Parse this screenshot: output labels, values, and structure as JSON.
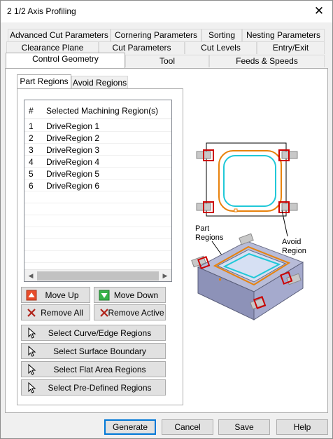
{
  "window": {
    "title": "2 1/2 Axis Profiling"
  },
  "tabs_row1": [
    {
      "label": "Advanced Cut Parameters"
    },
    {
      "label": "Cornering Parameters"
    },
    {
      "label": "Sorting"
    },
    {
      "label": "Nesting Parameters"
    }
  ],
  "tabs_row2": [
    {
      "label": "Clearance Plane"
    },
    {
      "label": "Cut Parameters"
    },
    {
      "label": "Cut Levels"
    },
    {
      "label": "Entry/Exit"
    }
  ],
  "tabs_row3": [
    {
      "label": "Control Geometry"
    },
    {
      "label": "Tool"
    },
    {
      "label": "Feeds & Speeds"
    }
  ],
  "subtabs": [
    {
      "label": "Part Regions"
    },
    {
      "label": "Avoid Regions"
    }
  ],
  "list": {
    "header_num": "#",
    "header_name": "Selected Machining Region(s)",
    "rows": [
      {
        "num": "1",
        "name": "DriveRegion 1"
      },
      {
        "num": "2",
        "name": "DriveRegion 2"
      },
      {
        "num": "3",
        "name": "DriveRegion 3"
      },
      {
        "num": "4",
        "name": "DriveRegion 4"
      },
      {
        "num": "5",
        "name": "DriveRegion 5"
      },
      {
        "num": "6",
        "name": "DriveRegion 6"
      }
    ]
  },
  "buttons": {
    "move_up": "Move Up",
    "move_down": "Move Down",
    "remove_all": "Remove All",
    "remove_active": "Remove Active",
    "select_curve": "Select Curve/Edge Regions",
    "select_surface": "Select Surface Boundary",
    "select_flat": "Select Flat Area Regions",
    "select_predefined": "Select Pre-Defined Regions"
  },
  "illustration": {
    "part_label_1": "Part",
    "part_label_2": "Regions",
    "avoid_label_1": "Avoid",
    "avoid_label_2": "Region"
  },
  "footer": {
    "generate": "Generate",
    "cancel": "Cancel",
    "save": "Save",
    "help": "Help"
  },
  "colors": {
    "part_region": "#e8820c",
    "toolpath": "#20c8d8",
    "avoid_region": "#cc0000",
    "move_up_icon": "#e84c2a",
    "move_down_icon": "#38b24a"
  }
}
